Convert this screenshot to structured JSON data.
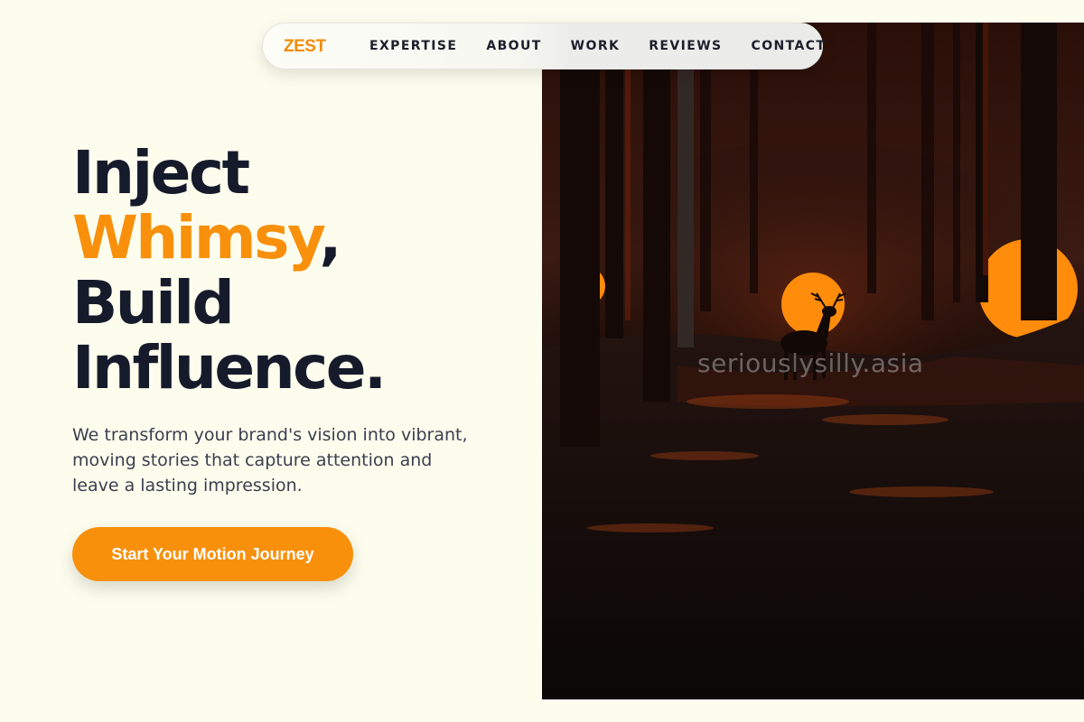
{
  "brand": {
    "logo_text": "ZEST",
    "accent_color": "#f8900c"
  },
  "nav": {
    "items": [
      {
        "label": "EXPERTISE"
      },
      {
        "label": "ABOUT"
      },
      {
        "label": "WORK"
      },
      {
        "label": "REVIEWS"
      },
      {
        "label": "CONTACT"
      }
    ]
  },
  "hero": {
    "headline": {
      "line1": "Inject",
      "line2_accent": "Whimsy",
      "line2_suffix": ",",
      "line3": "Build",
      "line4": "Influence."
    },
    "subtitle": "We transform your brand's vision into vibrant, moving stories that capture attention and leave a lasting impression.",
    "cta_label": "Start Your Motion Journey",
    "image": {
      "watermark": "seriouslysilly.asia"
    }
  },
  "colors": {
    "background": "#fdfdee",
    "text_dark": "#161b2b",
    "body_text": "#3a3f4c"
  }
}
